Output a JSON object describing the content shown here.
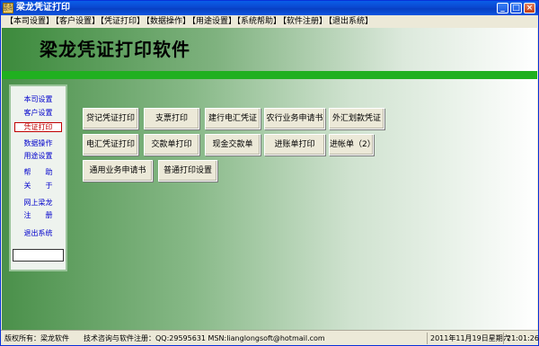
{
  "window": {
    "title": "梁龙凭证打印",
    "icon_text": "梁龙软件"
  },
  "menu": [
    "【本司设置】",
    "【客户设置】",
    "【凭证打印】",
    "【数据操作】",
    "【用途设置】",
    "【系统帮助】",
    "【软件注册】",
    "【退出系统】"
  ],
  "header": {
    "title": "梁龙凭证打印软件"
  },
  "sidebar": {
    "items": [
      "本司设置",
      "客户设置",
      "凭证打印",
      "数据操作",
      "用途设置",
      "帮　　助",
      "关　　于",
      "网上梁龙",
      "注　　册",
      "退出系统"
    ],
    "active": "凭证打印",
    "input_value": ""
  },
  "buttons": [
    "贷记凭证打印",
    "支票打印",
    "建行电汇凭证",
    "农行业务申请书",
    "外汇划款凭证",
    "电汇凭证打印",
    "交款单打印",
    "现金交款单",
    "进账单打印",
    "进帐单（2）",
    "通用业务申请书",
    "普通打印设置"
  ],
  "status": {
    "left": "版权所有：梁龙软件　　技术咨询与软件注册：QQ:29595631 MSN:lianglongsoft@hotmail.com",
    "date": "2011年11月19日星期六",
    "time": "21:01:26"
  },
  "colors": {
    "title_bar": "#0a47d0",
    "accent_green": "#20b020",
    "sidebar_link": "#0000cc",
    "active_red": "#c00000"
  }
}
